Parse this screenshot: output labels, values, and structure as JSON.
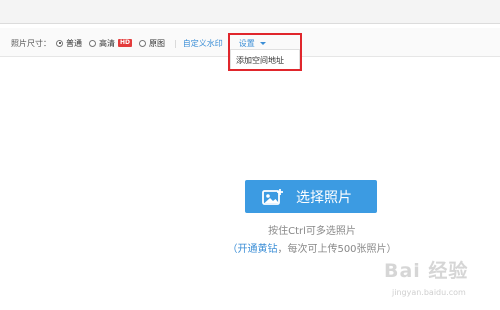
{
  "toolbar": {
    "size_label": "照片尺寸：",
    "options": [
      {
        "label": "普通",
        "selected": true
      },
      {
        "label": "高清",
        "selected": false,
        "badge": "HD"
      },
      {
        "label": "原图",
        "selected": false
      }
    ],
    "separator": "|",
    "watermark_link": "自定义水印",
    "settings_label": "设置"
  },
  "dropdown": {
    "items": [
      "添加空间地址"
    ]
  },
  "upload": {
    "button_label": "选择照片",
    "hint": "按住Ctrl可多选照片",
    "paren_open": "（",
    "vip_link": "开通黄钻",
    "vip_rest": "，每次可上传500张照片）"
  },
  "watermark": {
    "title": "Bai 经验",
    "sub": "jingyan.baidu.com"
  },
  "colors": {
    "accent": "#3c9be2",
    "link": "#3b8ed6",
    "highlight": "#e0262c",
    "hd_badge": "#e43c3c"
  }
}
